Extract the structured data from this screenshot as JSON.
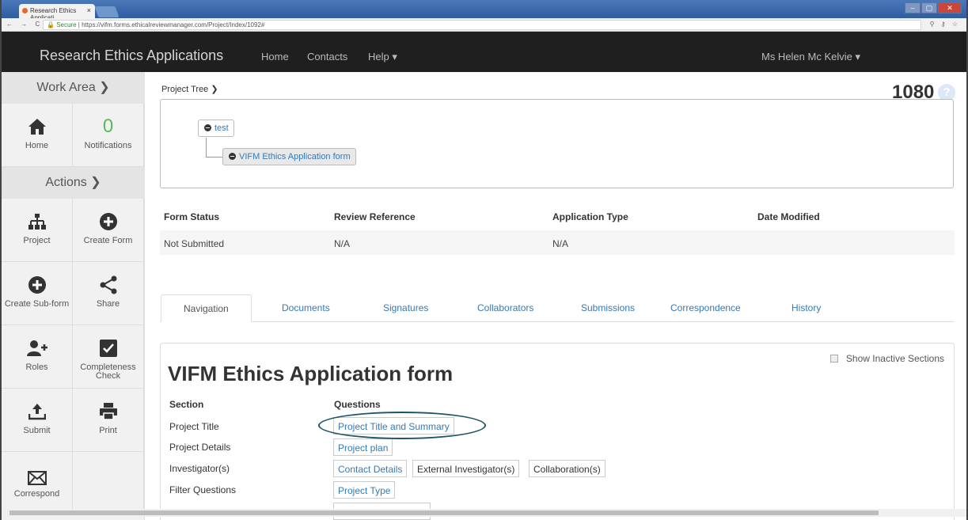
{
  "browser": {
    "tab_title": "Research Ethics Applicati",
    "tab_close": "×",
    "nav_glyphs": "← → C",
    "url_secure": "Secure",
    "url": "https://vifm.forms.ethicalreviewmanager.com/Project/Index/1092#",
    "right_glyphs": "⚲ ⚷ ☆",
    "window_controls": [
      "–",
      "▢",
      "✕"
    ]
  },
  "navbar": {
    "brand": "Research Ethics Applications",
    "links": [
      "Home",
      "Contacts",
      "Help ▾"
    ],
    "user": "Ms Helen Mc Kelvie ▾"
  },
  "sidebar": {
    "work_area_heading": "Work Area ❯",
    "actions_heading": "Actions ❯",
    "home": "Home",
    "notifications_count": "0",
    "notifications": "Notifications",
    "project": "Project",
    "create_form": "Create Form",
    "create_subform": "Create Sub-form",
    "share": "Share",
    "roles": "Roles",
    "completeness_check": "Completeness Check",
    "submit": "Submit",
    "print": "Print",
    "correspond": "Correspond"
  },
  "main": {
    "project_tree_label": "Project Tree ❯",
    "project_number": "1080",
    "help_glyph": "?",
    "tree": {
      "root": "test",
      "child": "VIFM Ethics Application form"
    },
    "status": {
      "headers": [
        "Form Status",
        "Review Reference",
        "Application Type",
        "Date Modified"
      ],
      "values": [
        "Not Submitted",
        "N/A",
        "N/A",
        ""
      ]
    },
    "tabs": [
      "Navigation",
      "Documents",
      "Signatures",
      "Collaborators",
      "Submissions",
      "Correspondence",
      "History"
    ],
    "show_inactive": "Show Inactive Sections",
    "form_title": "VIFM Ethics Application form",
    "section_header": "Section",
    "questions_header": "Questions",
    "sections": [
      {
        "name": "Project Title",
        "questions": [
          "Project Title and Summary"
        ]
      },
      {
        "name": "Project Details",
        "questions": [
          "Project plan"
        ]
      },
      {
        "name": "Investigator(s)",
        "questions": [
          "Contact Details",
          "External Investigator(s)",
          "Collaboration(s)"
        ]
      },
      {
        "name": "Filter Questions",
        "questions": [
          "Project Type"
        ]
      }
    ]
  },
  "colors": {
    "navbar_bg": "#1f1f1f",
    "link": "#337ab7",
    "highlight_ring": "#1b5566",
    "sidebar_bg": "#f1f1f1"
  }
}
